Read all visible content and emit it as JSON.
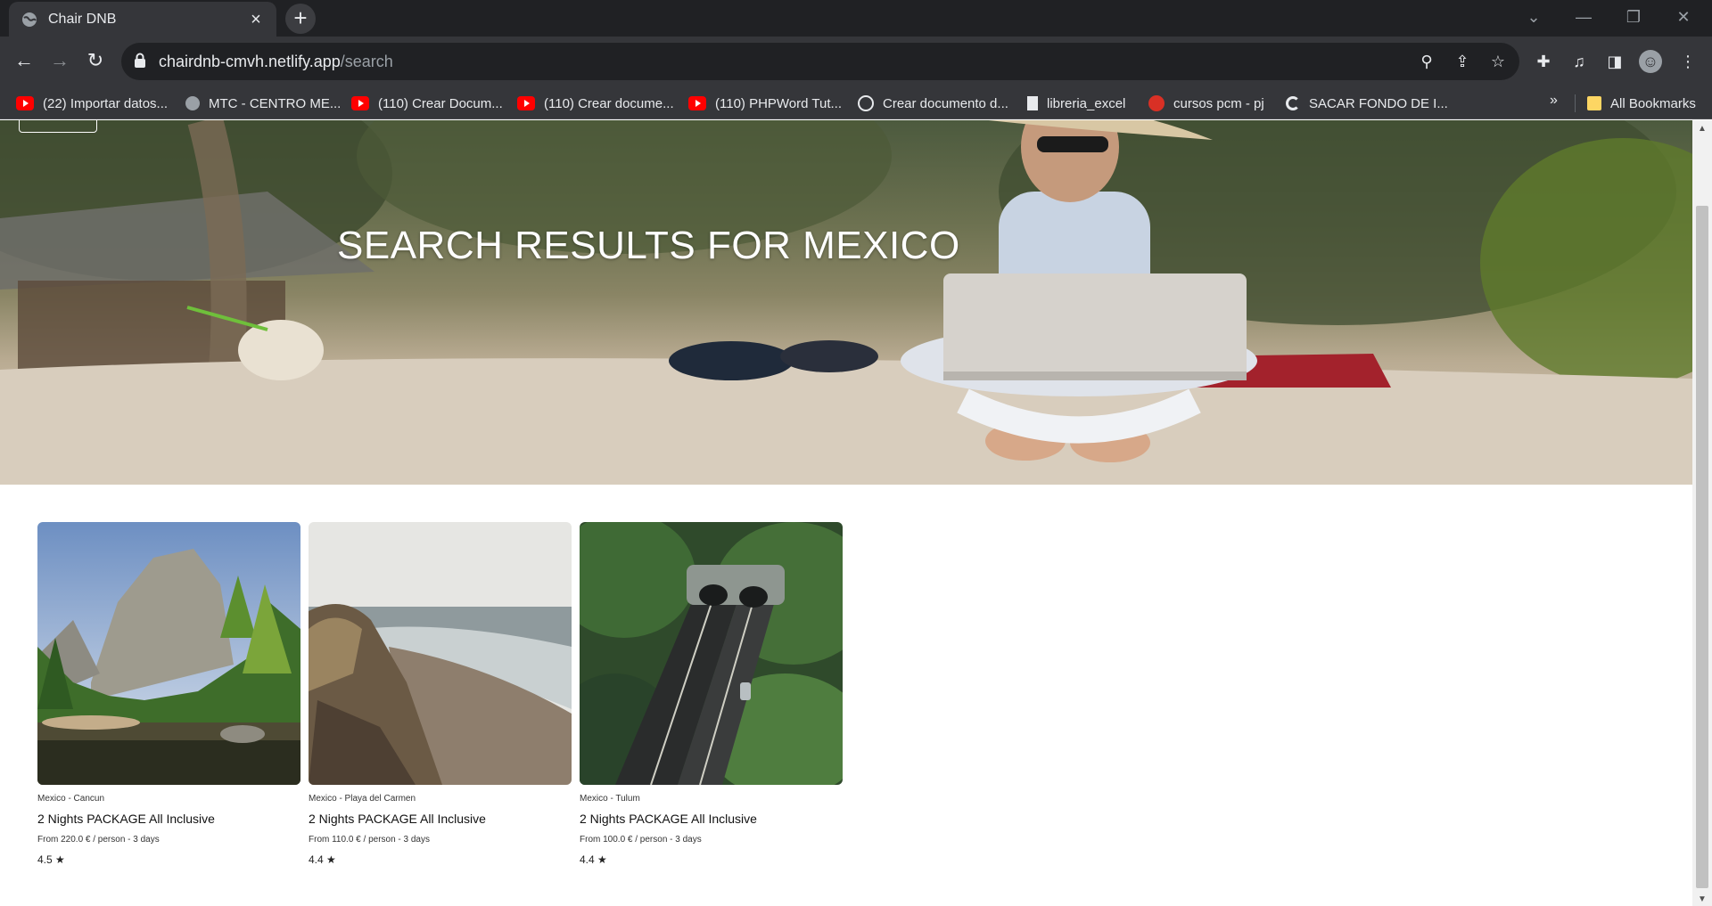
{
  "browser": {
    "tab_title": "Chair DNB",
    "url_host": "chairdnb-cmvh.netlify.app",
    "url_path": "/search",
    "bookmarks": [
      {
        "label": "(22) Importar datos...",
        "icon": "youtube-icon"
      },
      {
        "label": "MTC - CENTRO ME...",
        "icon": "globe-icon"
      },
      {
        "label": "(110) Crear Docum...",
        "icon": "youtube-icon"
      },
      {
        "label": "(110) Crear docume...",
        "icon": "youtube-icon"
      },
      {
        "label": "(110) PHPWord Tut...",
        "icon": "youtube-icon"
      },
      {
        "label": "Crear documento d...",
        "icon": "wordpress-icon"
      },
      {
        "label": "libreria_excel",
        "icon": "book-icon"
      },
      {
        "label": "cursos pcm - pj",
        "icon": "seal-icon"
      },
      {
        "label": "SACAR FONDO DE I...",
        "icon": "c-icon"
      }
    ],
    "more_bookmarks": "»",
    "all_bookmarks": "All Bookmarks"
  },
  "hero": {
    "title": "SEARCH RESULTS FOR MEXICO"
  },
  "results": [
    {
      "location": "Mexico - Cancun",
      "title": "2 Nights PACKAGE All Inclusive",
      "price": "From 220.0 € / person - 3 days",
      "rating": "4.5 ★"
    },
    {
      "location": "Mexico - Playa del Carmen",
      "title": "2 Nights PACKAGE All Inclusive",
      "price": "From 110.0 € / person - 3 days",
      "rating": "4.4 ★"
    },
    {
      "location": "Mexico - Tulum",
      "title": "2 Nights PACKAGE All Inclusive",
      "price": "From 100.0 € / person - 3 days",
      "rating": "4.4 ★"
    }
  ],
  "colors": {
    "chrome_dark": "#202124",
    "chrome_toolbar": "#35363a",
    "hero_text": "#ffffff"
  }
}
